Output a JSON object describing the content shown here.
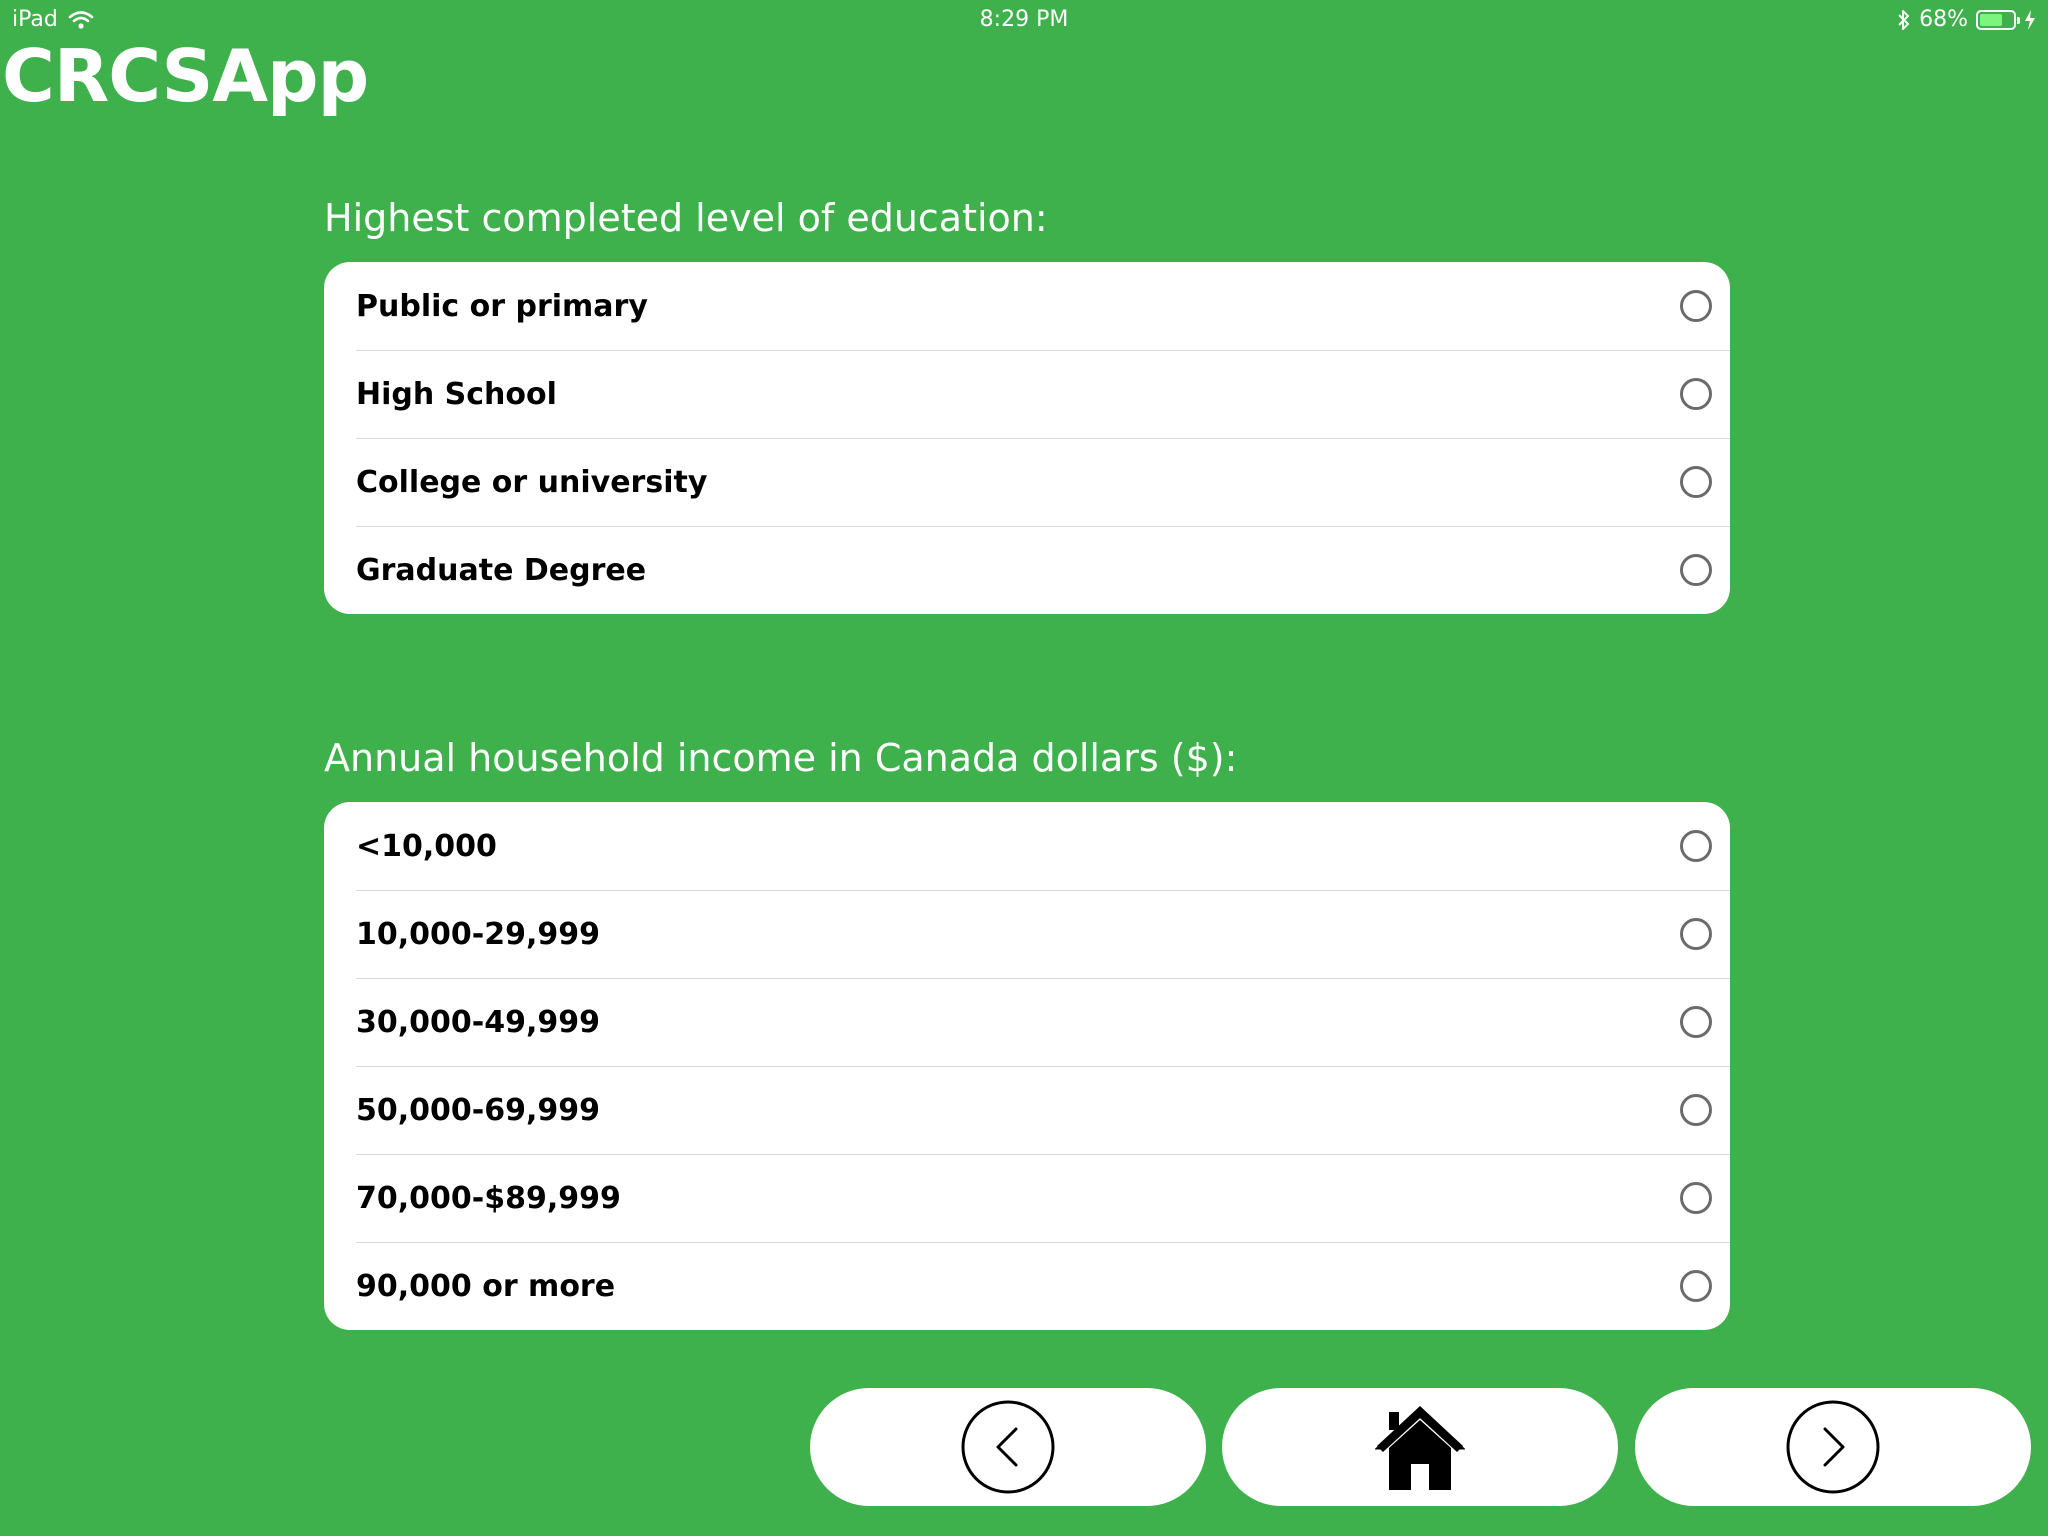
{
  "status_bar": {
    "device": "iPad",
    "time": "8:29 PM",
    "battery": "68%",
    "battery_level": 0.68
  },
  "app": {
    "title": "CRCSApp",
    "accent_color": "#3fb14c"
  },
  "education": {
    "label": "Highest completed level of education:",
    "options": [
      {
        "label": "Public or primary",
        "selected": false
      },
      {
        "label": "High School",
        "selected": false
      },
      {
        "label": "College or university",
        "selected": false
      },
      {
        "label": "Graduate Degree",
        "selected": false
      }
    ]
  },
  "income": {
    "label": "Annual household income in Canada dollars ($):",
    "options": [
      {
        "label": "<10,000",
        "selected": false
      },
      {
        "label": "10,000-29,999",
        "selected": false
      },
      {
        "label": "30,000-49,999",
        "selected": false
      },
      {
        "label": "50,000-69,999",
        "selected": false
      },
      {
        "label": "70,000-$89,999",
        "selected": false
      },
      {
        "label": "90,000 or more",
        "selected": false
      }
    ]
  },
  "nav": {
    "back_icon": "chevron-left-circle-icon",
    "home_icon": "home-icon",
    "next_icon": "chevron-right-circle-icon"
  }
}
